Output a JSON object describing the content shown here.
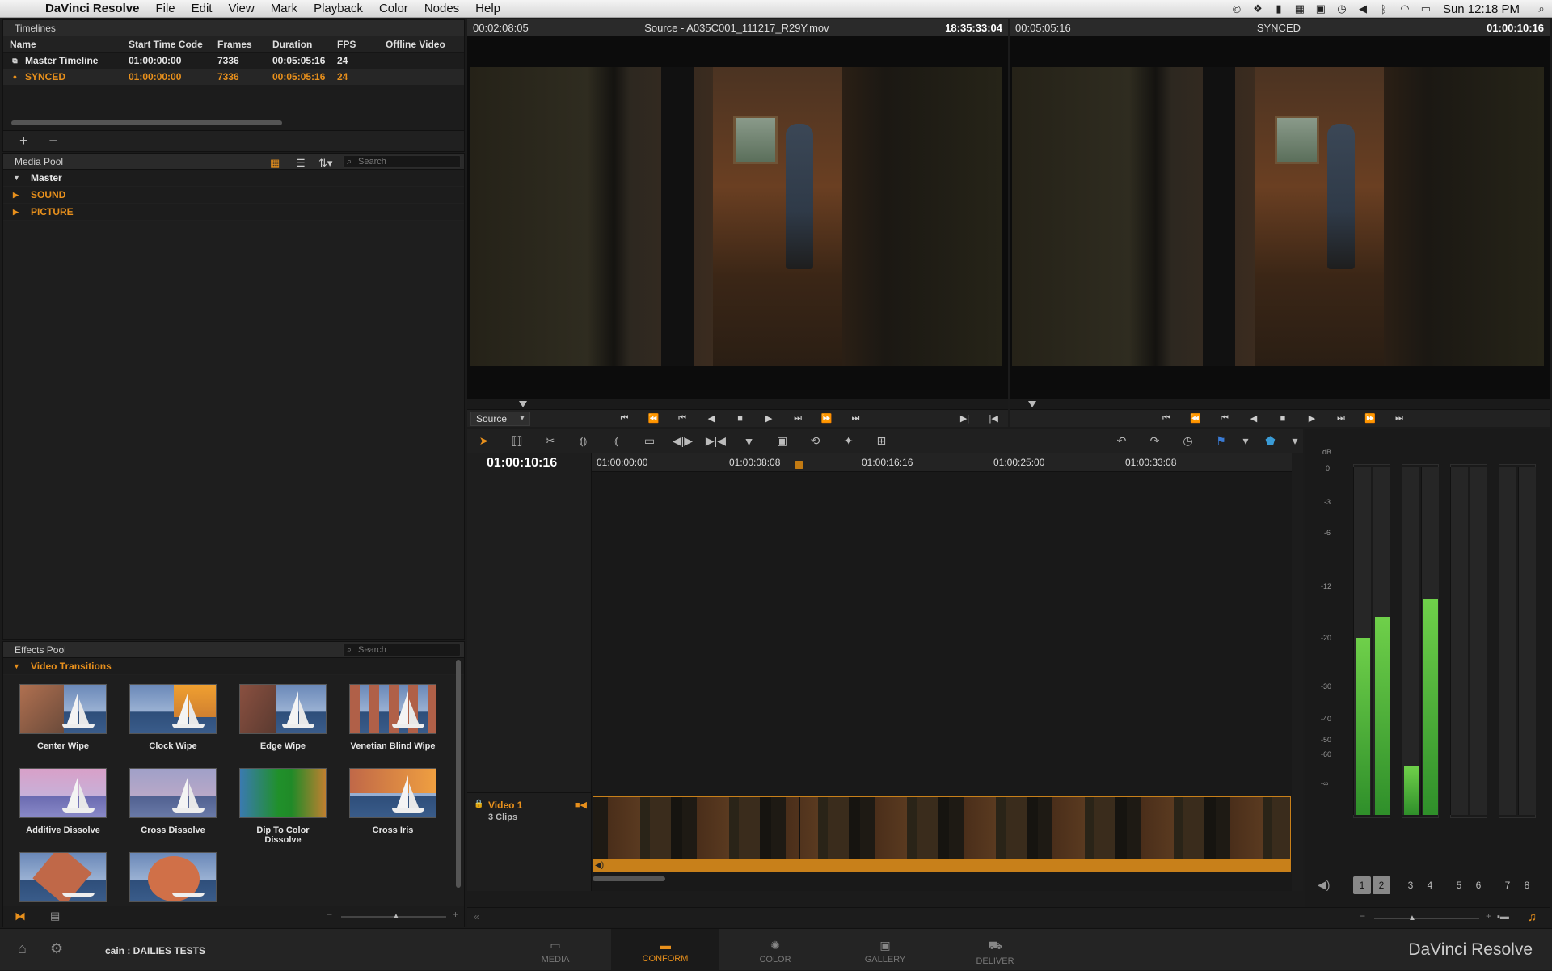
{
  "menubar": {
    "app_name": "DaVinci Resolve",
    "menus": [
      "File",
      "Edit",
      "View",
      "Mark",
      "Playback",
      "Color",
      "Nodes",
      "Help"
    ],
    "clock": "Sun 12:18 PM"
  },
  "timelines": {
    "title": "Timelines",
    "columns": [
      "Name",
      "Start Time Code",
      "Frames",
      "Duration",
      "FPS",
      "Offline Video"
    ],
    "rows": [
      {
        "name": "Master Timeline",
        "start": "01:00:00:00",
        "frames": "7336",
        "duration": "00:05:05:16",
        "fps": "24",
        "offline": ""
      },
      {
        "name": "SYNCED",
        "start": "01:00:00:00",
        "frames": "7336",
        "duration": "00:05:05:16",
        "fps": "24",
        "offline": ""
      }
    ],
    "add_label": "+",
    "remove_label": "−"
  },
  "media_pool": {
    "title": "Media Pool",
    "search_placeholder": "Search",
    "bins": [
      "Master",
      "SOUND",
      "PICTURE"
    ]
  },
  "effects_pool": {
    "title": "Effects Pool",
    "search_placeholder": "Search",
    "category": "Video Transitions",
    "items": [
      "Center Wipe",
      "Clock Wipe",
      "Edge Wipe",
      "Venetian Blind Wipe",
      "Additive Dissolve",
      "Cross Dissolve",
      "Dip To Color Dissolve",
      "Cross Iris",
      "",
      ""
    ]
  },
  "viewer_left": {
    "tc_left": "00:02:08:05",
    "title": "Source - A035C001_111217_R29Y.mov",
    "tc_right": "18:35:33:04",
    "source_select": "Source",
    "scrub_pos": 0.095
  },
  "viewer_right": {
    "tc_left": "00:05:05:16",
    "title": "SYNCED",
    "tc_right": "01:00:10:16",
    "scrub_pos": 0.035
  },
  "timeline": {
    "current_tc": "01:00:10:16",
    "ruler_labels": [
      "01:00:00:00",
      "01:00:08:08",
      "01:00:16:16",
      "01:00:25:00",
      "01:00:33:08"
    ],
    "track_name": "Video 1",
    "track_clips": "3 Clips"
  },
  "meters": {
    "db_label": "dB",
    "scale": [
      "0",
      "-3",
      "-6",
      "-12",
      "-20",
      "-30",
      "-40",
      "-50",
      "-60",
      "-∞"
    ],
    "levels": [
      0.51,
      0.57,
      0.14,
      0.62,
      0,
      0,
      0,
      0
    ],
    "channels": [
      "1",
      "2",
      "3",
      "4",
      "5",
      "6",
      "7",
      "8"
    ]
  },
  "bottom": {
    "project": "cain : DAILIES TESTS",
    "tabs": [
      "MEDIA",
      "CONFORM",
      "COLOR",
      "GALLERY",
      "DELIVER"
    ],
    "active_tab": "CONFORM",
    "brand": "DaVinci Resolve"
  },
  "colors": {
    "accent": "#e8901c",
    "meter_green": "#4fb83a"
  }
}
